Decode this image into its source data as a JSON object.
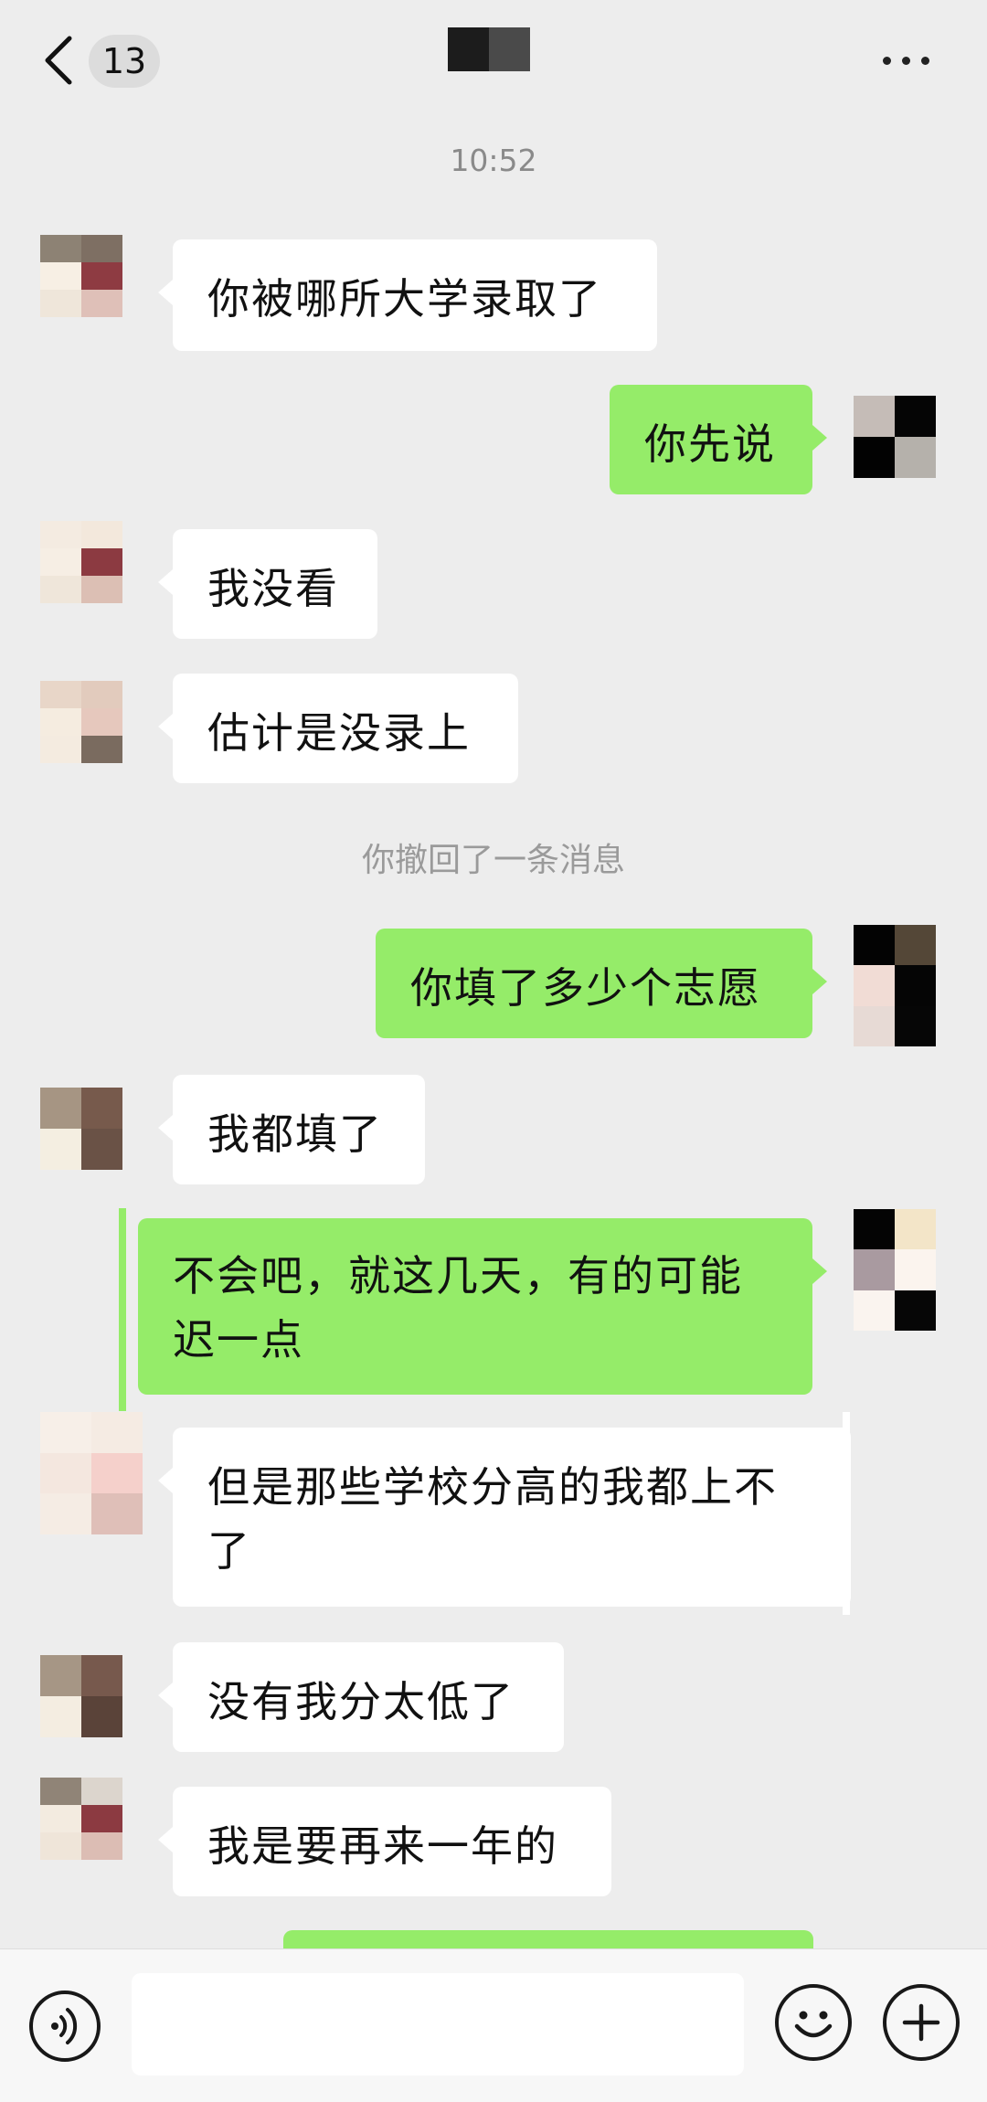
{
  "header": {
    "unread_count": "13",
    "title_colors": [
      "#1c1c1c",
      "#4a4a4a"
    ]
  },
  "timestamp": "10:52",
  "system_message": "你撤回了一条消息",
  "theme": {
    "background": "#ededed",
    "incoming_bubble": "#ffffff",
    "outgoing_bubble": "#95ec69",
    "text": "#111111"
  },
  "messages": [
    {
      "side": "in",
      "text": "你被哪所大学录取了",
      "avatar": [
        "#8d8274",
        "#7e6f63",
        "#f7efe4",
        "#8e3b42",
        "#efe6da",
        "#dfc0b8"
      ]
    },
    {
      "side": "out",
      "text": "你先说",
      "avatar": [
        "#c5bcb7",
        "#050505",
        "#020202",
        "#b5b1ab"
      ]
    },
    {
      "side": "in",
      "text": "我没看",
      "avatar": [
        "#f4ebe1",
        "#f3e8dc",
        "#f6eee4",
        "#8c3a41",
        "#efe6da",
        "#dcbfb4"
      ]
    },
    {
      "side": "in",
      "text": "估计是没录上",
      "avatar": [
        "#e8d6c8",
        "#e2cbbd",
        "#f5ece0",
        "#e6c8bd",
        "#f4ebe0",
        "#7a6b5f"
      ]
    },
    {
      "side": "out",
      "text": "你填了多少个志愿",
      "avatar": [
        "#030303",
        "#544737",
        "#f1dcd5",
        "#050505",
        "#e7dad5",
        "#060606"
      ]
    },
    {
      "side": "in",
      "text": "我都填了",
      "avatar": [
        "#a69583",
        "#775a4c",
        "#f4eee1",
        "#6a5246"
      ]
    },
    {
      "side": "out",
      "text": "不会吧，就这几天，有的可能迟一点",
      "avatar": [
        "#040404",
        "#f3e5c8",
        "#a99aa0",
        "#fbf4ee",
        "#faf4ef",
        "#060606"
      ]
    },
    {
      "side": "in",
      "text": "但是那些学校分高的我都上不了",
      "avatar": [
        "#f7efe8",
        "#f5ebe3",
        "#f4e7df",
        "#f5d0cb",
        "#f5ece4",
        "#dfbfb8"
      ]
    },
    {
      "side": "in",
      "text": "没有我分太低了",
      "avatar": [
        "#a69685",
        "#77594d",
        "#f4ede1",
        "#5a4339"
      ]
    },
    {
      "side": "in",
      "text": "我是要再来一年的",
      "avatar": [
        "#908477",
        "#dcd5cd",
        "#f3ebe0",
        "#8c3a41",
        "#efe5d9",
        "#dcbdb4"
      ]
    }
  ],
  "input": {
    "placeholder": ""
  }
}
